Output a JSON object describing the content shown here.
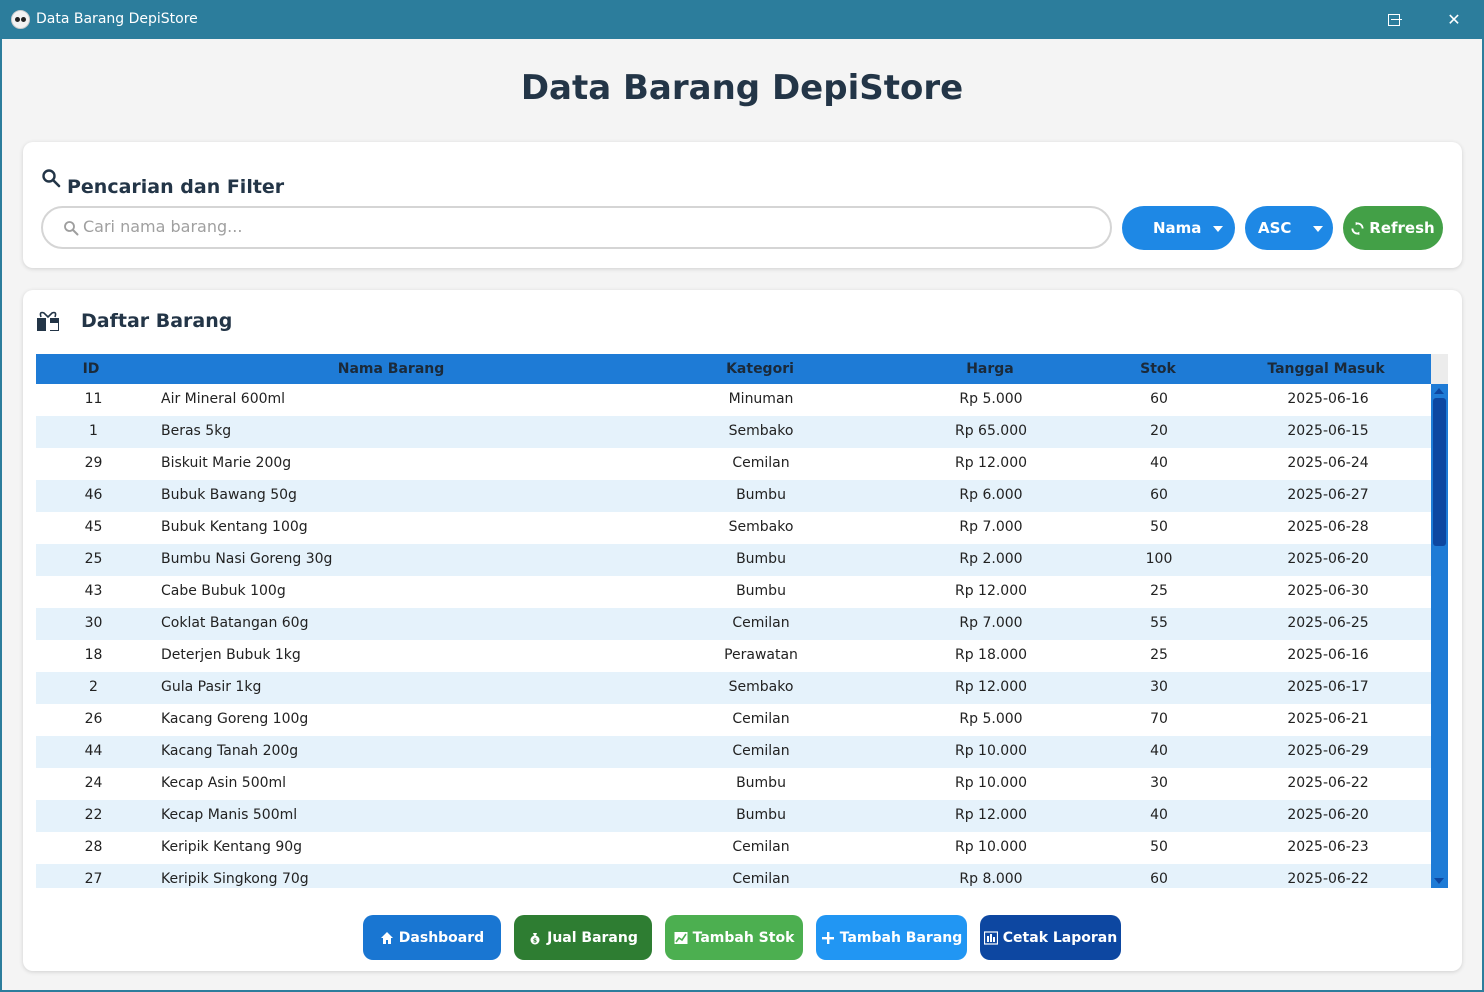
{
  "window": {
    "title": "Data Barang DepiStore",
    "icon": "panda-icon"
  },
  "page": {
    "title": "Data Barang DepiStore"
  },
  "filter": {
    "title": "Pencarian dan Filter",
    "search_placeholder": "Cari nama barang...",
    "sort_by": "Nama",
    "order": "ASC",
    "refresh_label": "Refresh"
  },
  "list": {
    "title": "Daftar Barang",
    "columns": [
      "ID",
      "Nama Barang",
      "Kategori",
      "Harga",
      "Stok",
      "Tanggal Masuk"
    ],
    "rows": [
      [
        "11",
        "Air Mineral 600ml",
        "Minuman",
        "Rp 5.000",
        "60",
        "2025-06-16"
      ],
      [
        "1",
        "Beras 5kg",
        "Sembako",
        "Rp 65.000",
        "20",
        "2025-06-15"
      ],
      [
        "29",
        "Biskuit Marie 200g",
        "Cemilan",
        "Rp 12.000",
        "40",
        "2025-06-24"
      ],
      [
        "46",
        "Bubuk Bawang 50g",
        "Bumbu",
        "Rp 6.000",
        "60",
        "2025-06-27"
      ],
      [
        "45",
        "Bubuk Kentang 100g",
        "Sembako",
        "Rp 7.000",
        "50",
        "2025-06-28"
      ],
      [
        "25",
        "Bumbu Nasi Goreng 30g",
        "Bumbu",
        "Rp 2.000",
        "100",
        "2025-06-20"
      ],
      [
        "43",
        "Cabe Bubuk 100g",
        "Bumbu",
        "Rp 12.000",
        "25",
        "2025-06-30"
      ],
      [
        "30",
        "Coklat Batangan 60g",
        "Cemilan",
        "Rp 7.000",
        "55",
        "2025-06-25"
      ],
      [
        "18",
        "Deterjen Bubuk 1kg",
        "Perawatan",
        "Rp 18.000",
        "25",
        "2025-06-16"
      ],
      [
        "2",
        "Gula Pasir 1kg",
        "Sembako",
        "Rp 12.000",
        "30",
        "2025-06-17"
      ],
      [
        "26",
        "Kacang Goreng 100g",
        "Cemilan",
        "Rp 5.000",
        "70",
        "2025-06-21"
      ],
      [
        "44",
        "Kacang Tanah 200g",
        "Cemilan",
        "Rp 10.000",
        "40",
        "2025-06-29"
      ],
      [
        "24",
        "Kecap Asin 500ml",
        "Bumbu",
        "Rp 10.000",
        "30",
        "2025-06-22"
      ],
      [
        "22",
        "Kecap Manis 500ml",
        "Bumbu",
        "Rp 12.000",
        "40",
        "2025-06-20"
      ],
      [
        "28",
        "Keripik Kentang 90g",
        "Cemilan",
        "Rp 10.000",
        "50",
        "2025-06-23"
      ],
      [
        "27",
        "Keripik Singkong 70g",
        "Cemilan",
        "Rp 8.000",
        "60",
        "2025-06-22"
      ]
    ]
  },
  "actions": {
    "dashboard": "Dashboard",
    "jual": "Jual Barang",
    "tambah_stok": "Tambah Stok",
    "tambah_barang": "Tambah Barang",
    "cetak": "Cetak Laporan"
  },
  "colors": {
    "titlebar": "#2c7d9c",
    "header": "#1e7bd6",
    "row_alt": "#e5f2fb",
    "primary": "#1976d2",
    "success": "#43a047"
  }
}
